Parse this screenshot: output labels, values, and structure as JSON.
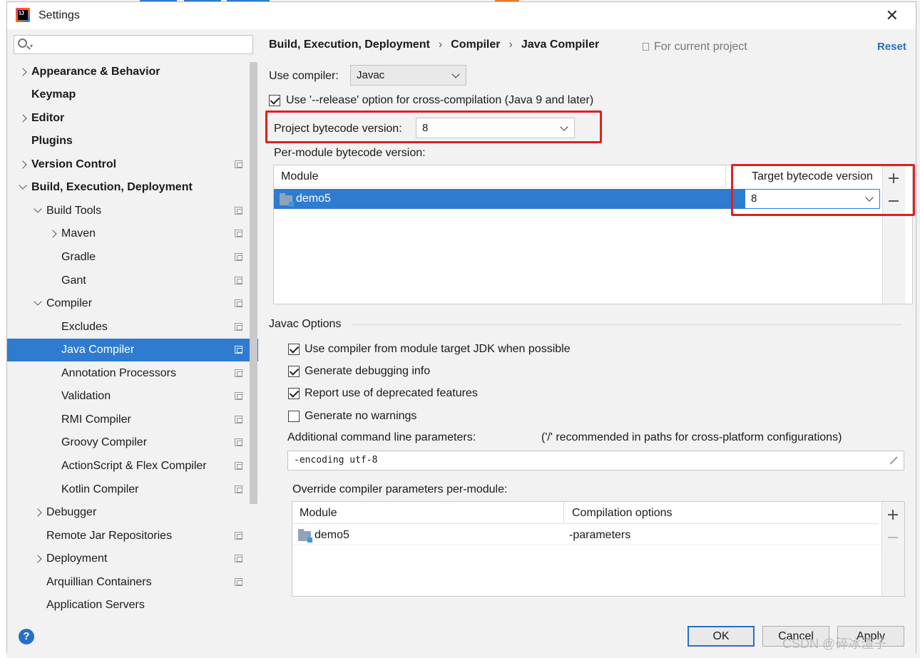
{
  "window": {
    "title": "Settings"
  },
  "search": {
    "placeholder": ""
  },
  "sidebar": {
    "items": [
      {
        "label": "Appearance & Behavior"
      },
      {
        "label": "Keymap"
      },
      {
        "label": "Editor"
      },
      {
        "label": "Plugins"
      },
      {
        "label": "Version Control"
      },
      {
        "label": "Build, Execution, Deployment"
      },
      {
        "label": "Build Tools"
      },
      {
        "label": "Maven"
      },
      {
        "label": "Gradle"
      },
      {
        "label": "Gant"
      },
      {
        "label": "Compiler"
      },
      {
        "label": "Excludes"
      },
      {
        "label": "Java Compiler"
      },
      {
        "label": "Annotation Processors"
      },
      {
        "label": "Validation"
      },
      {
        "label": "RMI Compiler"
      },
      {
        "label": "Groovy Compiler"
      },
      {
        "label": "ActionScript & Flex Compiler"
      },
      {
        "label": "Kotlin Compiler"
      },
      {
        "label": "Debugger"
      },
      {
        "label": "Remote Jar Repositories"
      },
      {
        "label": "Deployment"
      },
      {
        "label": "Arquillian Containers"
      },
      {
        "label": "Application Servers"
      }
    ]
  },
  "header": {
    "breadcrumb": [
      "Build, Execution, Deployment",
      "Compiler",
      "Java Compiler"
    ],
    "for_current_project": "For current project",
    "reset": "Reset"
  },
  "compiler": {
    "use_compiler_label": "Use compiler:",
    "use_compiler_value": "Javac",
    "release_option_label": "Use '--release' option for cross-compilation (Java 9 and later)",
    "release_option_checked": true,
    "project_bytecode_label": "Project bytecode version:",
    "project_bytecode_value": "8",
    "per_module_label": "Per-module bytecode version:",
    "module_table": {
      "col_module": "Module",
      "col_target": "Target bytecode version",
      "rows": [
        {
          "module": "demo5",
          "target": "8"
        }
      ]
    }
  },
  "javac": {
    "section_title": "Javac Options",
    "options": [
      {
        "label": "Use compiler from module target JDK when possible",
        "checked": true
      },
      {
        "label": "Generate debugging info",
        "checked": true
      },
      {
        "label": "Report use of deprecated features",
        "checked": true
      },
      {
        "label": "Generate no warnings",
        "checked": false
      }
    ],
    "additional_params_label": "Additional command line parameters:",
    "additional_params_hint": "('/' recommended in paths for cross-platform configurations)",
    "additional_params_value": "-encoding utf-8",
    "override_label": "Override compiler parameters per-module:",
    "override_table": {
      "col_module": "Module",
      "col_options": "Compilation options",
      "rows": [
        {
          "module": "demo5",
          "options": "-parameters"
        }
      ]
    }
  },
  "footer": {
    "help": "?",
    "ok": "OK",
    "cancel": "Cancel",
    "apply": "Apply",
    "watermark": "CSDN @碎冰渣子"
  },
  "colors": {
    "accent": "#2f7bd0",
    "highlight": "#e02020",
    "link": "#2470c7"
  },
  "icons": [
    "search-icon",
    "chevron-right-icon",
    "chevron-down-icon",
    "project-scope-icon",
    "folder-module-icon",
    "add-icon",
    "remove-icon",
    "expand-icon",
    "help-icon",
    "close-icon"
  ]
}
